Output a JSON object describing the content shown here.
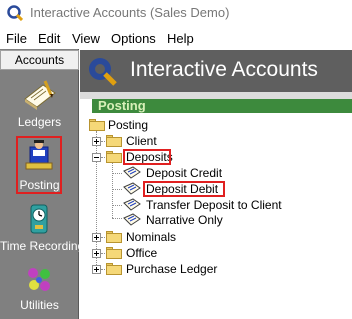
{
  "window": {
    "title": "Interactive Accounts (Sales Demo)"
  },
  "menu": [
    "File",
    "Edit",
    "View",
    "Options",
    "Help"
  ],
  "leftnav": {
    "header": "Accounts",
    "items": [
      {
        "label": "Ledgers",
        "icon": "ledger-icon",
        "selected": false
      },
      {
        "label": "Posting",
        "icon": "posting-icon",
        "selected": true
      },
      {
        "label": "Time Recording",
        "icon": "clock-icon",
        "selected": false
      },
      {
        "label": "Utilities",
        "icon": "utilities-icon",
        "selected": false
      }
    ]
  },
  "header": {
    "title": "Interactive Accounts"
  },
  "panel": {
    "title": "Posting"
  },
  "tree": {
    "root": "Posting",
    "client": "Client",
    "deposits": "Deposits",
    "deposit_credit": "Deposit Credit",
    "deposit_debit": "Deposit Debit",
    "transfer_deposit": "Transfer Deposit to Client",
    "narrative_only": "Narrative Only",
    "nominals": "Nominals",
    "office": "Office",
    "purchase_ledger": "Purchase Ledger"
  },
  "colors": {
    "highlight": "#e02020",
    "panel_header": "#3d8a3d",
    "sidebar": "#808080",
    "header": "#5f5f5f"
  }
}
